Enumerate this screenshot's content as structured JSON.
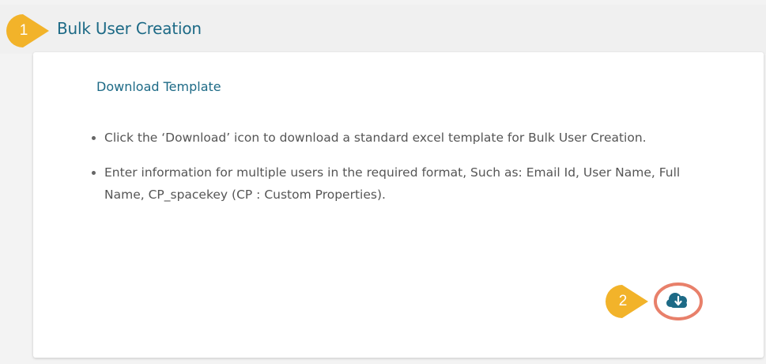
{
  "section": {
    "step": "1",
    "title": "Bulk User Creation"
  },
  "card": {
    "title": "Download Template",
    "bullets": [
      "Click the ‘Download’ icon to download a standard excel template for Bulk User Creation.",
      "Enter information for multiple users in the required format, Such as: Email Id, User Name, Full Name, CP_spacekey (CP : Custom Properties)."
    ]
  },
  "download": {
    "step": "2",
    "icon": "cloud-download-icon",
    "highlight_color": "#e8806a",
    "icon_color": "#1d6a86"
  },
  "colors": {
    "accent": "#1d6a86",
    "badge": "#f2b32a"
  }
}
